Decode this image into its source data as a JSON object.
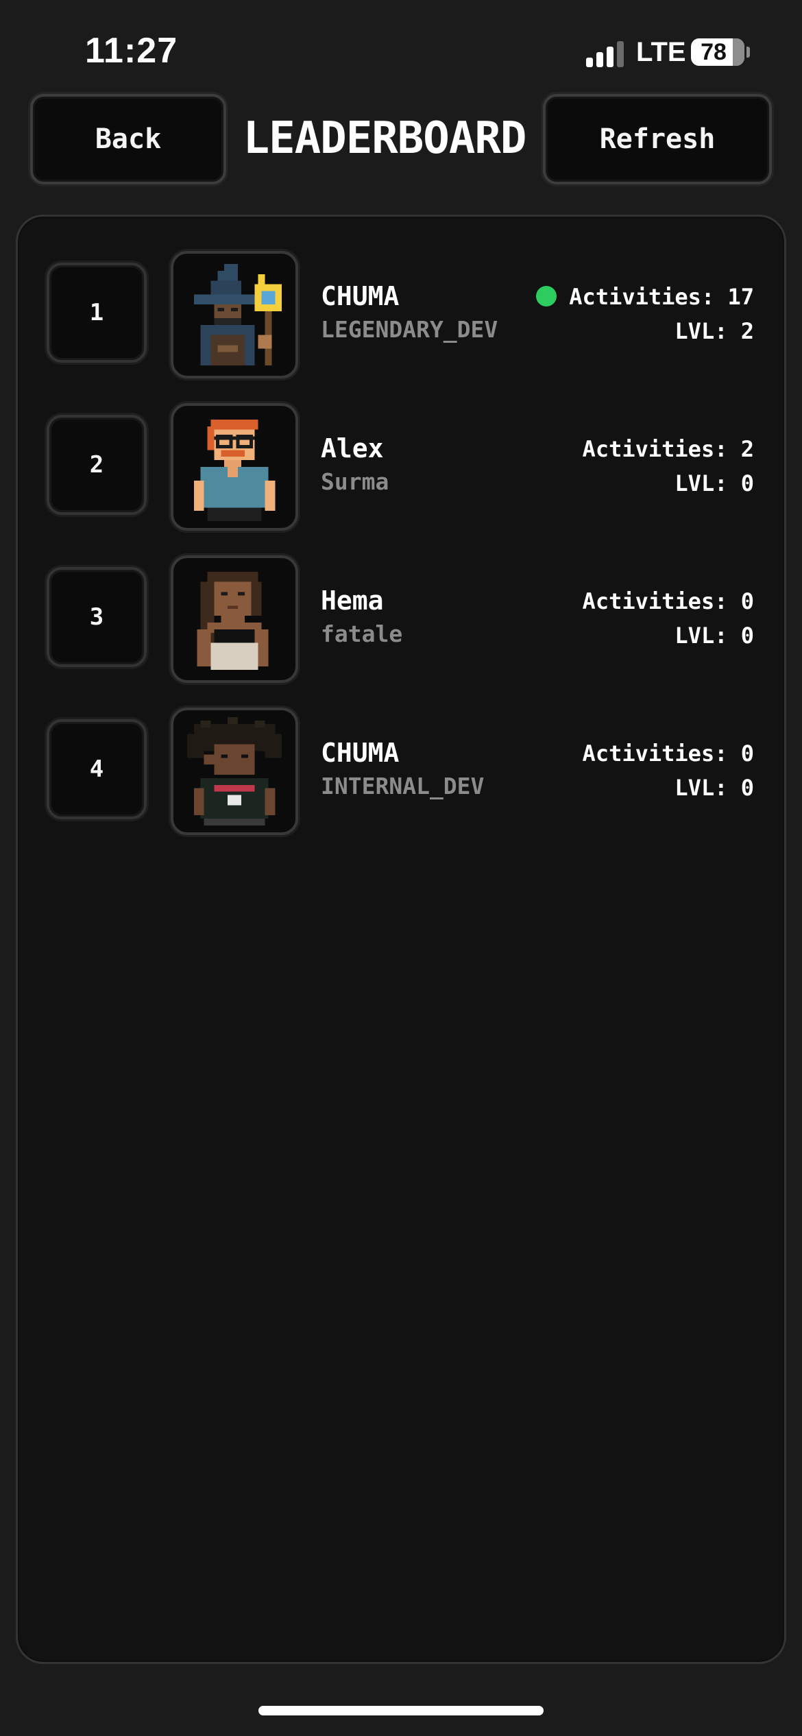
{
  "status_bar": {
    "time": "11:27",
    "network": "LTE",
    "battery": "78",
    "battery_percent": 78
  },
  "header": {
    "back_label": "Back",
    "title": "LEADERBOARD",
    "refresh_label": "Refresh"
  },
  "leaderboard": {
    "rows": [
      {
        "rank": "1",
        "name": "CHUMA",
        "title": "LEGENDARY_DEV",
        "activities": "Activities: 17",
        "level": "LVL: 2",
        "online": true,
        "avatar": "wizard-avatar"
      },
      {
        "rank": "2",
        "name": "Alex",
        "title": "Surma",
        "activities": "Activities: 2",
        "level": "LVL: 0",
        "online": false,
        "avatar": "glasses-avatar"
      },
      {
        "rank": "3",
        "name": "Hema",
        "title": "fatale",
        "activities": "Activities: 0",
        "level": "LVL: 0",
        "online": false,
        "avatar": "long-hair-avatar"
      },
      {
        "rank": "4",
        "name": "CHUMA",
        "title": "INTERNAL_DEV",
        "activities": "Activities: 0",
        "level": "LVL: 0",
        "online": false,
        "avatar": "curly-hair-avatar"
      }
    ]
  },
  "colors": {
    "background": "#1b1b1b",
    "panel": "#121212",
    "online": "#2dcc5e",
    "muted_text": "#8c8c8c"
  }
}
